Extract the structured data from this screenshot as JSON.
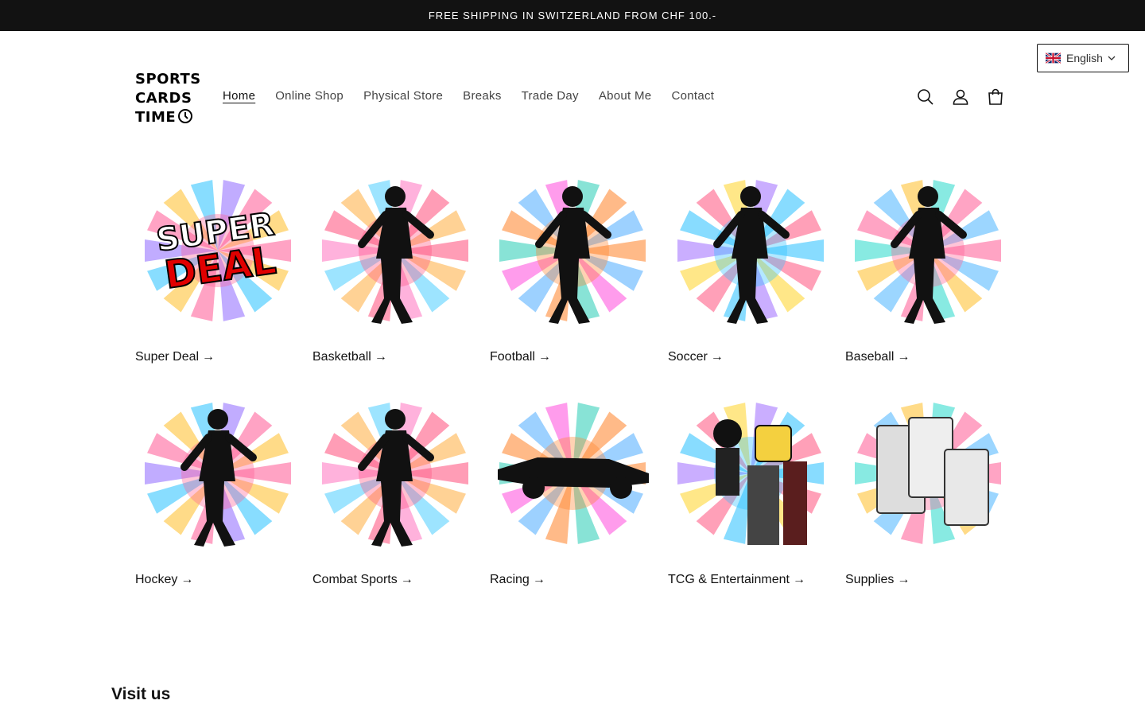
{
  "announcement": "FREE SHIPPING IN SWITZERLAND FROM CHF 100.-",
  "language": {
    "label": "English",
    "flag_icon": "uk-flag-icon"
  },
  "logo": {
    "line1": "SPORTS",
    "line2": "CARDS",
    "line3": "TIME"
  },
  "nav": [
    "Home",
    "Online Shop",
    "Physical Store",
    "Breaks",
    "Trade Day",
    "About Me",
    "Contact"
  ],
  "header_icons": [
    "search-icon",
    "account-icon",
    "cart-icon"
  ],
  "arrow": "→",
  "collections": [
    {
      "label": "Super Deal",
      "image": "super-deal-splash"
    },
    {
      "label": "Basketball",
      "image": "basketball-player-splash"
    },
    {
      "label": "Football",
      "image": "football-player-splash"
    },
    {
      "label": "Soccer",
      "image": "soccer-player-splash"
    },
    {
      "label": "Baseball",
      "image": "baseball-player-splash"
    },
    {
      "label": "Hockey",
      "image": "hockey-player-splash"
    },
    {
      "label": "Combat Sports",
      "image": "fighter-splash"
    },
    {
      "label": "Racing",
      "image": "race-car-splash"
    },
    {
      "label": "TCG & Entertainment",
      "image": "cartoon-characters-splash"
    },
    {
      "label": "Supplies",
      "image": "card-supplies-splash"
    }
  ],
  "visit_heading": "Visit us",
  "colors": {
    "bar": "#121212",
    "text": "#121212"
  }
}
